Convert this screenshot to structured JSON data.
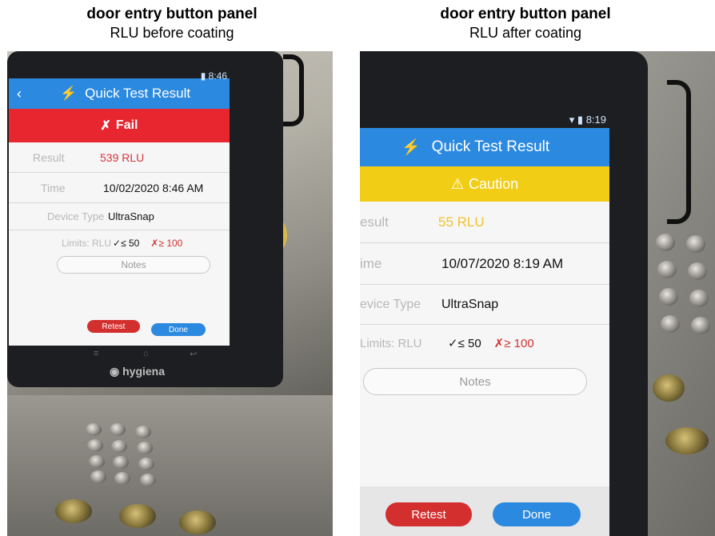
{
  "left": {
    "caption_title": "door entry button panel",
    "caption_subtitle": "RLU before coating",
    "status_time": "8:46",
    "header_title": "Quick Test Result",
    "banner_text": "Fail",
    "result_label": "Result",
    "result_value": "539 RLU",
    "time_label": "Time",
    "time_value": "10/02/2020 8:46 AM",
    "device_label": "Device Type",
    "device_value": "UltraSnap",
    "limits_label": "Limits: RLU",
    "limit_pass": "≤ 50",
    "limit_fail": "≥ 100",
    "notes_label": "Notes",
    "retest_label": "Retest",
    "done_label": "Done",
    "brand": "hygiena"
  },
  "right": {
    "caption_title": "door entry button panel",
    "caption_subtitle": "RLU after coating",
    "status_time": "8:19",
    "header_title": "Quick Test Result",
    "banner_text": "Caution",
    "result_label": "esult",
    "result_value": "55 RLU",
    "time_label": "ime",
    "time_value": "10/07/2020 8:19 AM",
    "device_label": "evice Type",
    "device_value": "UltraSnap",
    "limits_label": "Limits: RLU",
    "limit_pass": "≤ 50",
    "limit_fail": "≥ 100",
    "notes_label": "Notes",
    "retest_label": "Retest",
    "done_label": "Done"
  },
  "colors": {
    "header_blue": "#2b8ae0",
    "fail_red": "#e8262f",
    "caution_yellow": "#f2cd16",
    "result_fail": "#d6333d",
    "result_caution": "#f2c230"
  },
  "icons": [
    "bolt-icon",
    "back-arrow-icon",
    "fail-x-icon",
    "caution-triangle-icon",
    "check-icon",
    "cross-icon",
    "battery-icon",
    "wifi-icon"
  ]
}
